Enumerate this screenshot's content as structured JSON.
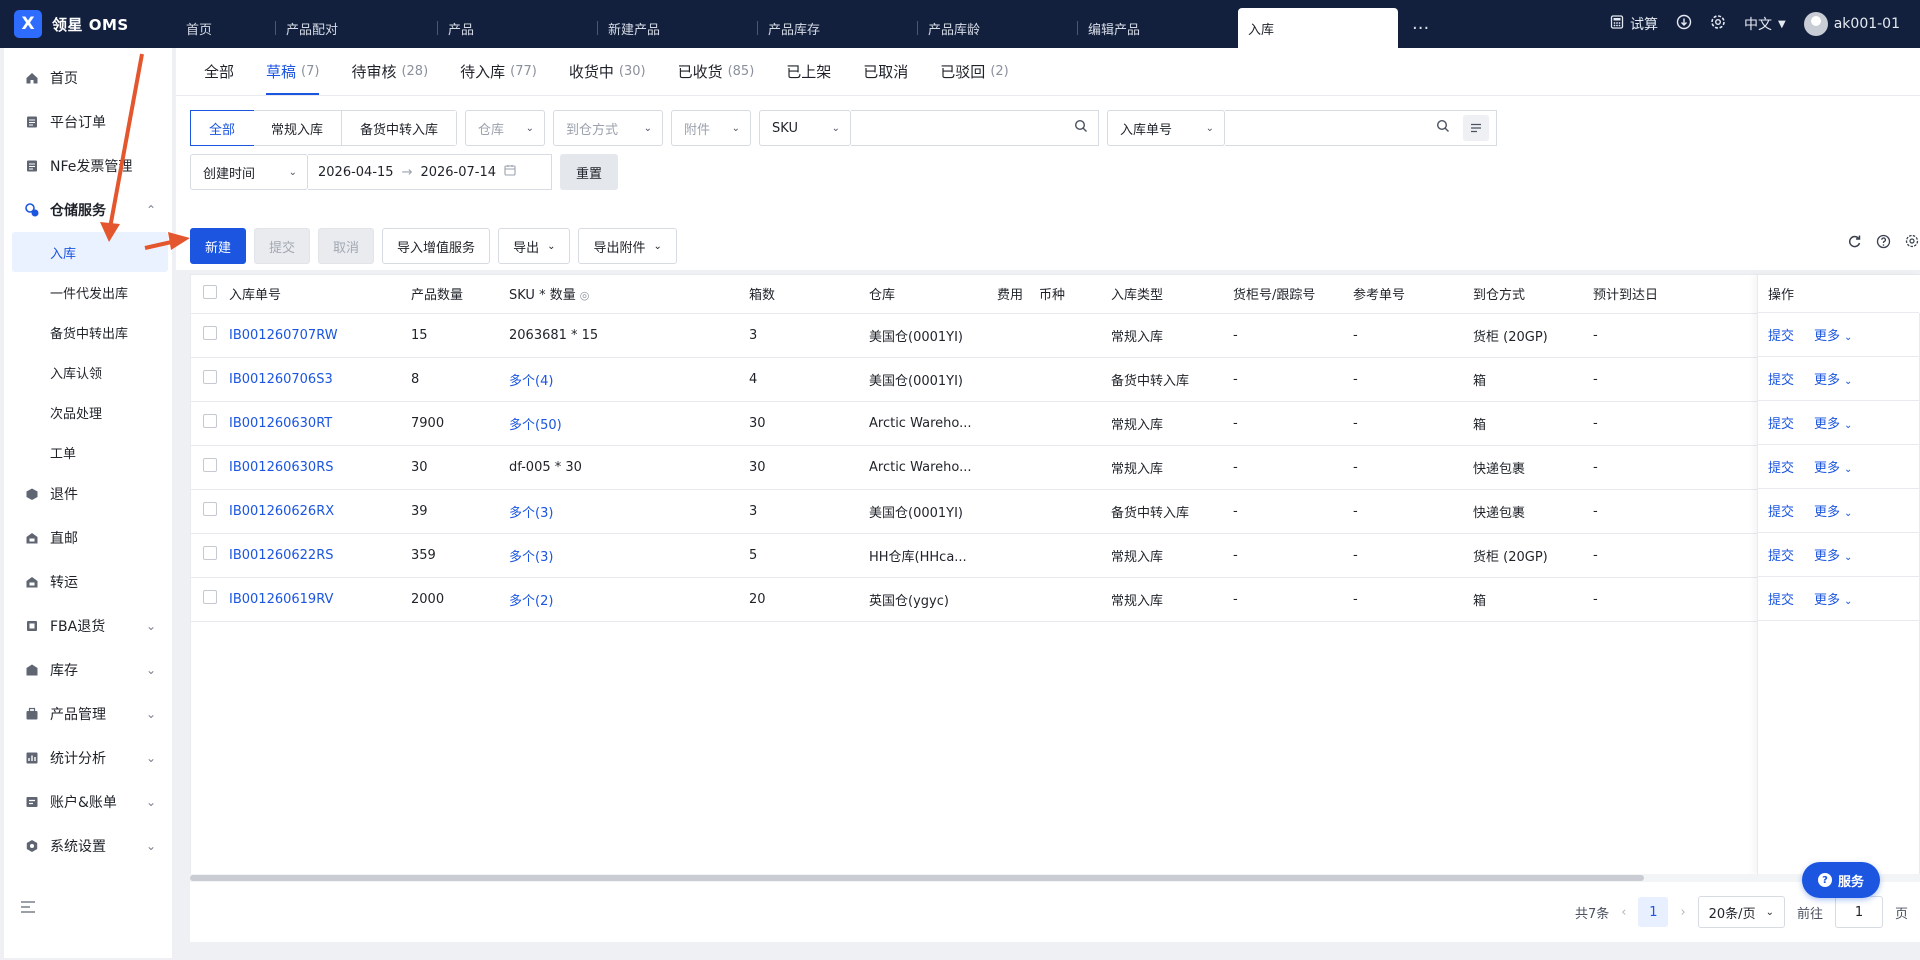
{
  "app": {
    "logo_mark": "X",
    "name": "领星 OMS"
  },
  "top_tabs": [
    "首页",
    "产品配对",
    "产品",
    "新建产品",
    "产品库存",
    "产品库龄",
    "编辑产品",
    "入库"
  ],
  "top_more": "···",
  "top_right": {
    "trial": "试算",
    "lang": "中文",
    "user": "ak001-01"
  },
  "sidebar": {
    "items": [
      {
        "label": "首页",
        "icon": "home-icon"
      },
      {
        "label": "平台订单",
        "icon": "order-icon"
      },
      {
        "label": "NFe发票管理",
        "icon": "invoice-icon"
      },
      {
        "label": "仓储服务",
        "icon": "warehouse-icon"
      },
      {
        "label": "退件",
        "icon": "return-icon"
      },
      {
        "label": "直邮",
        "icon": "direct-mail-icon"
      },
      {
        "label": "转运",
        "icon": "transfer-icon"
      },
      {
        "label": "FBA退货",
        "icon": "fba-icon"
      },
      {
        "label": "库存",
        "icon": "inventory-icon"
      },
      {
        "label": "产品管理",
        "icon": "product-icon"
      },
      {
        "label": "统计分析",
        "icon": "stats-icon"
      },
      {
        "label": "账户&账单",
        "icon": "account-icon"
      },
      {
        "label": "系统设置",
        "icon": "settings-icon"
      }
    ],
    "sub_items": [
      "入库",
      "一件代发出库",
      "备货中转出库",
      "入库认领",
      "次品处理",
      "工单"
    ]
  },
  "status_tabs": [
    {
      "label": "全部",
      "count": ""
    },
    {
      "label": "草稿",
      "count": "(7)"
    },
    {
      "label": "待审核",
      "count": "(28)"
    },
    {
      "label": "待入库",
      "count": "(77)"
    },
    {
      "label": "收货中",
      "count": "(30)"
    },
    {
      "label": "已收货",
      "count": "(85)"
    },
    {
      "label": "已上架",
      "count": ""
    },
    {
      "label": "已取消",
      "count": ""
    },
    {
      "label": "已驳回",
      "count": "(2)"
    }
  ],
  "filters": {
    "type_options": [
      "全部",
      "常规入库",
      "备货中转入库"
    ],
    "warehouse": "仓库",
    "arrival": "到仓方式",
    "attachment": "附件",
    "sku": "SKU",
    "inbound_no": "入库单号",
    "date_field": "创建时间",
    "date_from": "2026-04-15",
    "date_arrow": "→",
    "date_to": "2026-07-14",
    "reset": "重置"
  },
  "toolbar": {
    "new": "新建",
    "submit": "提交",
    "cancel": "取消",
    "import": "导入增值服务",
    "export": "导出",
    "export_att": "导出附件"
  },
  "table": {
    "headers": [
      "入库单号",
      "产品数量",
      "SKU * 数量",
      "箱数",
      "仓库",
      "费用",
      "币种",
      "入库类型",
      "货柜号/跟踪号",
      "参考单号",
      "到仓方式",
      "预计到达日",
      "操作"
    ],
    "rows": [
      {
        "no": "IB001260707RW",
        "qty": "15",
        "sku": "2063681 * 15",
        "sku_link": false,
        "boxes": "3",
        "wh": "美国仓(0001YI)",
        "fee": "",
        "cur": "",
        "type": "常规入库",
        "container": "-",
        "ref": "-",
        "arrival": "货柜 (20GP)",
        "eta": "-"
      },
      {
        "no": "IB001260706S3",
        "qty": "8",
        "sku": "多个(4)",
        "sku_link": true,
        "boxes": "4",
        "wh": "美国仓(0001YI)",
        "fee": "",
        "cur": "",
        "type": "备货中转入库",
        "container": "-",
        "ref": "-",
        "arrival": "箱",
        "eta": "-"
      },
      {
        "no": "IB001260630RT",
        "qty": "7900",
        "sku": "多个(50)",
        "sku_link": true,
        "boxes": "30",
        "wh": "Arctic Wareho...",
        "fee": "",
        "cur": "",
        "type": "常规入库",
        "container": "-",
        "ref": "-",
        "arrival": "箱",
        "eta": "-"
      },
      {
        "no": "IB001260630RS",
        "qty": "30",
        "sku": "df-005 * 30",
        "sku_link": false,
        "boxes": "30",
        "wh": "Arctic Wareho...",
        "fee": "",
        "cur": "",
        "type": "常规入库",
        "container": "-",
        "ref": "-",
        "arrival": "快递包裹",
        "eta": "-"
      },
      {
        "no": "IB001260626RX",
        "qty": "39",
        "sku": "多个(3)",
        "sku_link": true,
        "boxes": "3",
        "wh": "美国仓(0001YI)",
        "fee": "",
        "cur": "",
        "type": "备货中转入库",
        "container": "-",
        "ref": "-",
        "arrival": "快递包裹",
        "eta": "-"
      },
      {
        "no": "IB001260622RS",
        "qty": "359",
        "sku": "多个(3)",
        "sku_link": true,
        "boxes": "5",
        "wh": "HH仓库(HHca...",
        "fee": "",
        "cur": "",
        "type": "常规入库",
        "container": "-",
        "ref": "-",
        "arrival": "货柜 (20GP)",
        "eta": "-"
      },
      {
        "no": "IB001260619RV",
        "qty": "2000",
        "sku": "多个(2)",
        "sku_link": true,
        "boxes": "20",
        "wh": "英国仓(ygyc)",
        "fee": "",
        "cur": "",
        "type": "常规入库",
        "container": "-",
        "ref": "-",
        "arrival": "箱",
        "eta": "-"
      }
    ],
    "op_submit": "提交",
    "op_more": "更多"
  },
  "pager": {
    "total": "共7条",
    "page": "1",
    "size": "20条/页",
    "goto": "前往",
    "goto_value": "1",
    "page_unit": "页"
  },
  "service": "服务",
  "colors": {
    "brand": "#1b55e0",
    "topbar": "#12203d",
    "arrow": "#e4572e"
  }
}
